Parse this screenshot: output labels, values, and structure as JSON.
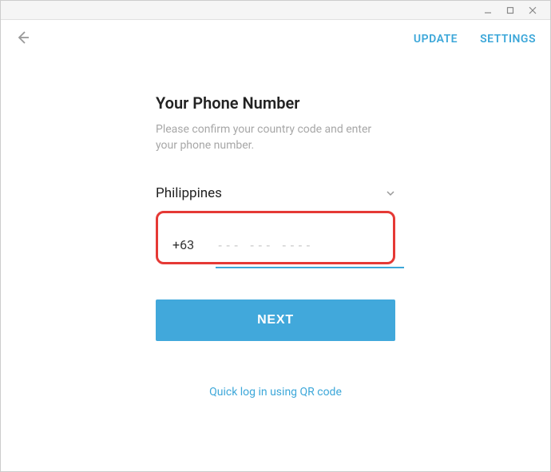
{
  "header": {
    "update": "UPDATE",
    "settings": "SETTINGS"
  },
  "main": {
    "title": "Your Phone Number",
    "subtitle": "Please confirm your country code and enter your phone number.",
    "country": "Philippines",
    "country_code": "+63",
    "phone_placeholder": "--- --- ----",
    "next_label": "NEXT",
    "qr_link": "Quick log in using QR code"
  }
}
